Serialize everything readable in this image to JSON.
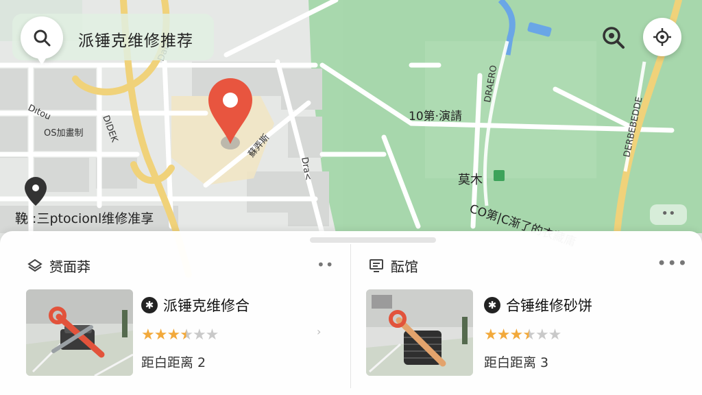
{
  "search": {
    "query": "派锤克维修推荐"
  },
  "map": {
    "labels": {
      "left_area": "鞔 :三ptocionl维修准享",
      "park_center": "10第·演請",
      "park_poi": "莫木",
      "park_road": "CO第|C渐了的衣藏庸"
    },
    "pin_color": "#e8553f"
  },
  "panel": {
    "sections": [
      {
        "title": "赟面莽",
        "icon": "layers-icon",
        "card": {
          "name": "派锤克维修合",
          "badge": "✱",
          "rating": 3.5,
          "distance": "距白距离 2"
        }
      },
      {
        "title": "酝馆",
        "icon": "monitor-icon",
        "card": {
          "name": "合锤维修砂饼",
          "badge": "✱",
          "rating": 3.5,
          "distance": "距白距离 3"
        }
      }
    ],
    "more_label": "••",
    "map_more_label": "••"
  }
}
